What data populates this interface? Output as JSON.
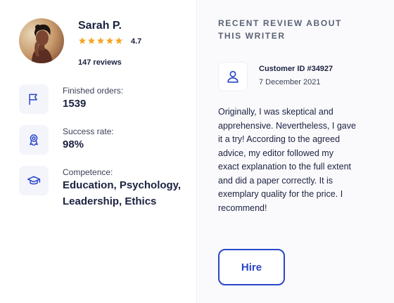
{
  "writer": {
    "name": "Sarah P.",
    "rating": "4.7",
    "rating_value": 4.7,
    "stars_filled": 5,
    "reviews": "147 reviews"
  },
  "stats": [
    {
      "icon": "flag-icon",
      "label": "Finished orders:",
      "value": "1539"
    },
    {
      "icon": "award-ribbon-icon",
      "label": "Success rate:",
      "value": "98%"
    },
    {
      "icon": "graduation-cap-icon",
      "label": "Competence:",
      "value_lines": [
        "Education, Psychology,",
        "Leadership, Ethics"
      ]
    }
  ],
  "review": {
    "section_title_lines": [
      "RECENT REVIEW ABOUT",
      "THIS WRITER"
    ],
    "user_icon": "user-icon",
    "customer_id": "Customer ID #34927",
    "date": "7 December 2021",
    "text_lines": [
      "Originally, I was skeptical and",
      "apprehensive. Nevertheless, I gave",
      "it a try! According to the agreed",
      "advice, my editor followed my",
      "exact explanation to the full extent",
      "and did a paper correctly. It is",
      "exemplary quality for the price. I",
      "recommend!"
    ]
  },
  "actions": {
    "hire_label": "Hire"
  },
  "colors": {
    "accent": "#2946c9",
    "star": "#f5a623",
    "text": "#1c2240",
    "icon_bg": "#f3f5fb",
    "panel_bg": "#fafafc"
  }
}
